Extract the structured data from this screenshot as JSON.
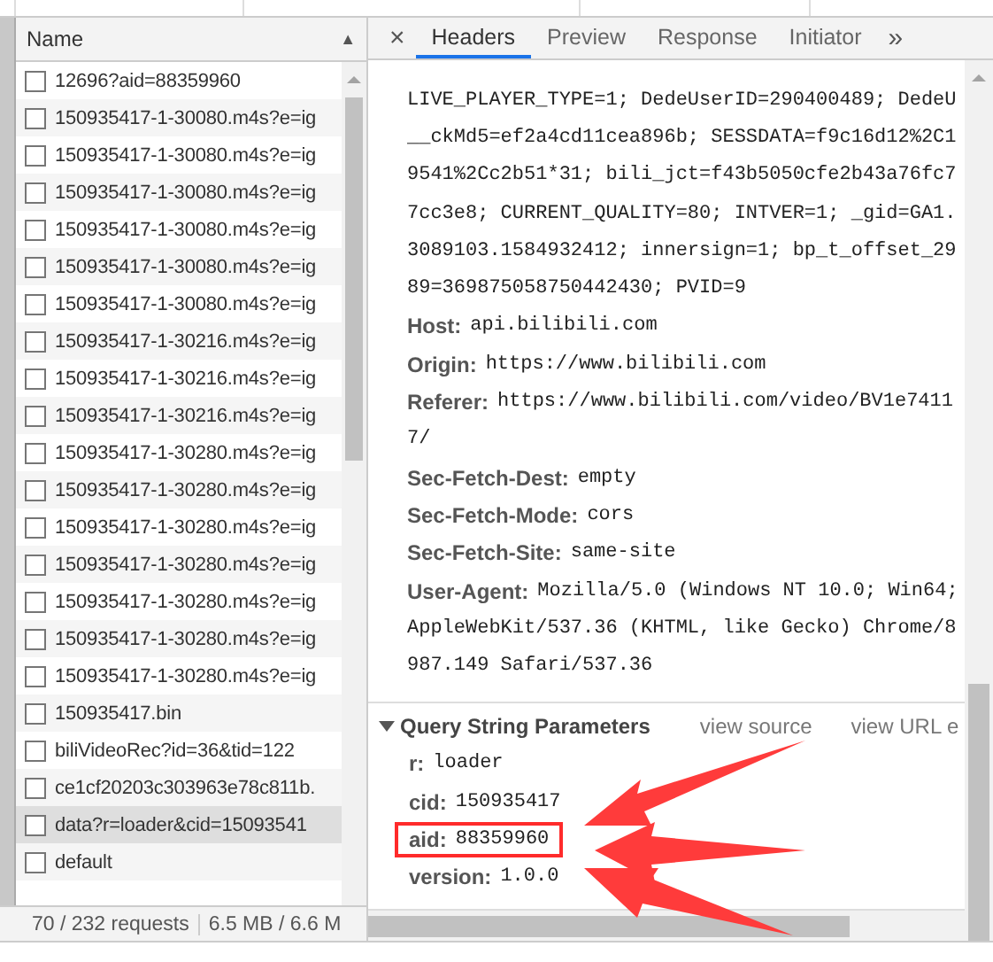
{
  "requests": {
    "column": "Name",
    "rows": [
      {
        "name": "12696?aid=88359960",
        "checked": false,
        "selected": false
      },
      {
        "name": "150935417-1-30080.m4s?e=ig",
        "checked": false,
        "selected": false
      },
      {
        "name": "150935417-1-30080.m4s?e=ig",
        "checked": false,
        "selected": false
      },
      {
        "name": "150935417-1-30080.m4s?e=ig",
        "checked": false,
        "selected": false
      },
      {
        "name": "150935417-1-30080.m4s?e=ig",
        "checked": false,
        "selected": false
      },
      {
        "name": "150935417-1-30080.m4s?e=ig",
        "checked": false,
        "selected": false
      },
      {
        "name": "150935417-1-30080.m4s?e=ig",
        "checked": false,
        "selected": false
      },
      {
        "name": "150935417-1-30216.m4s?e=ig",
        "checked": false,
        "selected": false
      },
      {
        "name": "150935417-1-30216.m4s?e=ig",
        "checked": false,
        "selected": false
      },
      {
        "name": "150935417-1-30216.m4s?e=ig",
        "checked": false,
        "selected": false
      },
      {
        "name": "150935417-1-30280.m4s?e=ig",
        "checked": false,
        "selected": false
      },
      {
        "name": "150935417-1-30280.m4s?e=ig",
        "checked": false,
        "selected": false
      },
      {
        "name": "150935417-1-30280.m4s?e=ig",
        "checked": false,
        "selected": false
      },
      {
        "name": "150935417-1-30280.m4s?e=ig",
        "checked": false,
        "selected": false
      },
      {
        "name": "150935417-1-30280.m4s?e=ig",
        "checked": false,
        "selected": false
      },
      {
        "name": "150935417-1-30280.m4s?e=ig",
        "checked": false,
        "selected": false
      },
      {
        "name": "150935417-1-30280.m4s?e=ig",
        "checked": false,
        "selected": false
      },
      {
        "name": "150935417.bin",
        "checked": false,
        "selected": false
      },
      {
        "name": "biliVideoRec?id=36&tid=122",
        "checked": false,
        "selected": false
      },
      {
        "name": "ce1cf20203c303963e78c811b.",
        "checked": false,
        "selected": false
      },
      {
        "name": "data?r=loader&cid=15093541",
        "checked": false,
        "selected": true
      },
      {
        "name": "default",
        "checked": false,
        "selected": false
      }
    ],
    "sort": "▲",
    "status": [
      "70 / 232 requests",
      "6.5 MB / 6.6 M"
    ]
  },
  "details": {
    "close": "×",
    "tabs": [
      {
        "label": "Headers",
        "selected": true
      },
      {
        "label": "Preview",
        "selected": false
      },
      {
        "label": "Response",
        "selected": false
      },
      {
        "label": "Initiator",
        "selected": false
      }
    ],
    "more": "»",
    "cookie_lines": [
      "LIVE_PLAYER_TYPE=1; DedeUserID=290400489; DedeU",
      "__ckMd5=ef2a4cd11cea896b; SESSDATA=f9c16d12%2C1",
      "9541%2Cc2b51*31; bili_jct=f43b5050cfe2b43a76fc7",
      "7cc3e8; CURRENT_QUALITY=80; INTVER=1; _gid=GA1.",
      "3089103.1584932412; innersign=1; bp_t_offset_29",
      "89=369875058750442430; PVID=9"
    ],
    "headers": [
      {
        "key": "Host:",
        "lines": [
          "api.bilibili.com"
        ]
      },
      {
        "key": "Origin:",
        "lines": [
          "https://www.bilibili.com"
        ]
      },
      {
        "key": "Referer:",
        "lines": [
          "https://www.bilibili.com/video/BV1e7411",
          "7/"
        ]
      },
      {
        "key": "Sec-Fetch-Dest:",
        "lines": [
          "empty"
        ]
      },
      {
        "key": "Sec-Fetch-Mode:",
        "lines": [
          "cors"
        ]
      },
      {
        "key": "Sec-Fetch-Site:",
        "lines": [
          "same-site"
        ]
      },
      {
        "key": "User-Agent:",
        "lines": [
          "Mozilla/5.0 (Windows NT 10.0; Win64;",
          "AppleWebKit/537.36 (KHTML, like Gecko) Chrome/8",
          "987.149 Safari/537.36"
        ]
      }
    ],
    "query": {
      "title": "Query String Parameters",
      "expanded": true,
      "links": [
        "view source",
        "view URL e"
      ],
      "params": [
        {
          "key": "r:",
          "value": "loader",
          "highlighted": false
        },
        {
          "key": "cid:",
          "value": "150935417",
          "highlighted": false
        },
        {
          "key": "aid:",
          "value": "88359960",
          "highlighted": true
        },
        {
          "key": "version:",
          "value": "1.0.0",
          "highlighted": false
        }
      ]
    }
  }
}
